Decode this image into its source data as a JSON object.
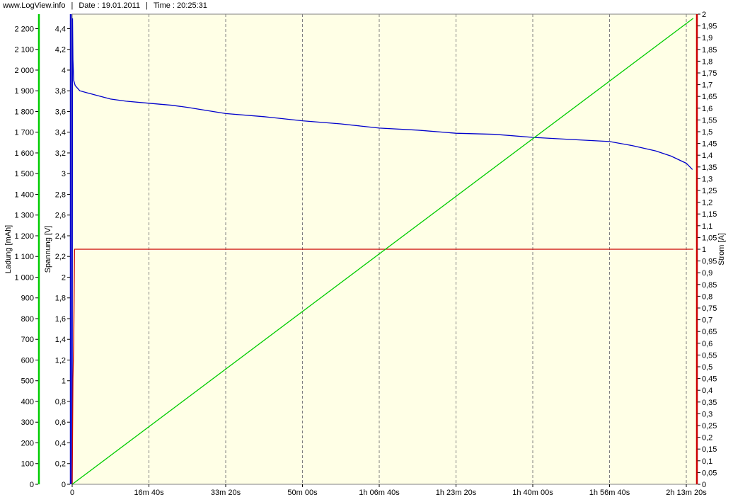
{
  "header": {
    "site": "www.LogView.info",
    "date": "Date : 19.01.2011",
    "time": "Time : 20:25:31"
  },
  "colors": {
    "plot_background": "#ffffe6",
    "ladung_axis": "#00cc00",
    "spannung_axis": "#0000cc",
    "strom_axis": "#cc0000",
    "grid": "#808080"
  },
  "chart_data": {
    "type": "line",
    "title": "",
    "xlabel": "",
    "x_unit": "seconds",
    "xlim": [
      0,
      8100
    ],
    "x_ticks": [
      {
        "value": 0,
        "label": "0"
      },
      {
        "value": 1000,
        "label": "16m 40s"
      },
      {
        "value": 2000,
        "label": "33m 20s"
      },
      {
        "value": 3000,
        "label": "50m 00s"
      },
      {
        "value": 4000,
        "label": "1h 06m 40s"
      },
      {
        "value": 5000,
        "label": "1h 23m 20s"
      },
      {
        "value": 6000,
        "label": "1h 40m 00s"
      },
      {
        "value": 7000,
        "label": "1h 56m 40s"
      },
      {
        "value": 8000,
        "label": "2h 13m 20s"
      }
    ],
    "grid": "vertical dashed",
    "axes": {
      "ladung": {
        "label": "Ladung [mAh]",
        "side": "left-outer",
        "ylim": [
          0,
          2270
        ],
        "ticks": [
          {
            "value": 0,
            "label": "0"
          },
          {
            "value": 100,
            "label": "100"
          },
          {
            "value": 200,
            "label": "200"
          },
          {
            "value": 300,
            "label": "300"
          },
          {
            "value": 400,
            "label": "400"
          },
          {
            "value": 500,
            "label": "500"
          },
          {
            "value": 600,
            "label": "600"
          },
          {
            "value": 700,
            "label": "700"
          },
          {
            "value": 800,
            "label": "800"
          },
          {
            "value": 900,
            "label": "900"
          },
          {
            "value": 1000,
            "label": "1 000"
          },
          {
            "value": 1100,
            "label": "1 100"
          },
          {
            "value": 1200,
            "label": "1 200"
          },
          {
            "value": 1300,
            "label": "1 300"
          },
          {
            "value": 1400,
            "label": "1 400"
          },
          {
            "value": 1500,
            "label": "1 500"
          },
          {
            "value": 1600,
            "label": "1 600"
          },
          {
            "value": 1700,
            "label": "1 700"
          },
          {
            "value": 1800,
            "label": "1 800"
          },
          {
            "value": 1900,
            "label": "1 900"
          },
          {
            "value": 2000,
            "label": "2 000"
          },
          {
            "value": 2100,
            "label": "2 100"
          },
          {
            "value": 2200,
            "label": "2 200"
          }
        ]
      },
      "spannung": {
        "label": "Spannung [V]",
        "side": "left-inner",
        "ylim": [
          0,
          4.54
        ],
        "ticks": [
          {
            "value": 0,
            "label": "0"
          },
          {
            "value": 0.2,
            "label": "0,2"
          },
          {
            "value": 0.4,
            "label": "0,4"
          },
          {
            "value": 0.6,
            "label": "0,6"
          },
          {
            "value": 0.8,
            "label": "0,8"
          },
          {
            "value": 1.0,
            "label": "1"
          },
          {
            "value": 1.2,
            "label": "1,2"
          },
          {
            "value": 1.4,
            "label": "1,4"
          },
          {
            "value": 1.6,
            "label": "1,6"
          },
          {
            "value": 1.8,
            "label": "1,8"
          },
          {
            "value": 2.0,
            "label": "2"
          },
          {
            "value": 2.2,
            "label": "2,2"
          },
          {
            "value": 2.4,
            "label": "2,4"
          },
          {
            "value": 2.6,
            "label": "2,6"
          },
          {
            "value": 2.8,
            "label": "2,8"
          },
          {
            "value": 3.0,
            "label": "3"
          },
          {
            "value": 3.2,
            "label": "3,2"
          },
          {
            "value": 3.4,
            "label": "3,4"
          },
          {
            "value": 3.6,
            "label": "3,6"
          },
          {
            "value": 3.8,
            "label": "3,8"
          },
          {
            "value": 4.0,
            "label": "4"
          },
          {
            "value": 4.2,
            "label": "4,2"
          },
          {
            "value": 4.4,
            "label": "4,4"
          }
        ]
      },
      "strom": {
        "label": "Strom [A]",
        "side": "right",
        "ylim": [
          0,
          2.0
        ],
        "ticks": [
          {
            "value": 0,
            "label": "0"
          },
          {
            "value": 0.05,
            "label": "0,05"
          },
          {
            "value": 0.1,
            "label": "0,1"
          },
          {
            "value": 0.15,
            "label": "0,15"
          },
          {
            "value": 0.2,
            "label": "0,2"
          },
          {
            "value": 0.25,
            "label": "0,25"
          },
          {
            "value": 0.3,
            "label": "0,3"
          },
          {
            "value": 0.35,
            "label": "0,35"
          },
          {
            "value": 0.4,
            "label": "0,4"
          },
          {
            "value": 0.45,
            "label": "0,45"
          },
          {
            "value": 0.5,
            "label": "0,5"
          },
          {
            "value": 0.55,
            "label": "0,55"
          },
          {
            "value": 0.6,
            "label": "0,6"
          },
          {
            "value": 0.65,
            "label": "0,65"
          },
          {
            "value": 0.7,
            "label": "0,7"
          },
          {
            "value": 0.75,
            "label": "0,75"
          },
          {
            "value": 0.8,
            "label": "0,8"
          },
          {
            "value": 0.85,
            "label": "0,85"
          },
          {
            "value": 0.9,
            "label": "0,9"
          },
          {
            "value": 0.95,
            "label": "0,95"
          },
          {
            "value": 1.0,
            "label": "1"
          },
          {
            "value": 1.05,
            "label": "1,05"
          },
          {
            "value": 1.1,
            "label": "1,1"
          },
          {
            "value": 1.15,
            "label": "1,15"
          },
          {
            "value": 1.2,
            "label": "1,2"
          },
          {
            "value": 1.25,
            "label": "1,25"
          },
          {
            "value": 1.3,
            "label": "1,3"
          },
          {
            "value": 1.35,
            "label": "1,35"
          },
          {
            "value": 1.4,
            "label": "1,4"
          },
          {
            "value": 1.45,
            "label": "1,45"
          },
          {
            "value": 1.5,
            "label": "1,5"
          },
          {
            "value": 1.55,
            "label": "1,55"
          },
          {
            "value": 1.6,
            "label": "1,6"
          },
          {
            "value": 1.65,
            "label": "1,65"
          },
          {
            "value": 1.7,
            "label": "1,7"
          },
          {
            "value": 1.75,
            "label": "1,75"
          },
          {
            "value": 1.8,
            "label": "1,8"
          },
          {
            "value": 1.85,
            "label": "1,85"
          },
          {
            "value": 1.9,
            "label": "1,9"
          },
          {
            "value": 1.95,
            "label": "1,95"
          },
          {
            "value": 2.0,
            "label": "2"
          }
        ]
      }
    },
    "series": [
      {
        "axis": "spannung",
        "color": "#0000cc",
        "x": [
          0,
          5,
          10,
          20,
          40,
          100,
          200,
          300,
          500,
          700,
          1000,
          1300,
          1500,
          2000,
          2500,
          3000,
          3500,
          4000,
          4500,
          5000,
          5500,
          6000,
          6500,
          7000,
          7300,
          7600,
          7800,
          8000,
          8080
        ],
        "y": [
          0,
          4.5,
          4.1,
          3.9,
          3.85,
          3.8,
          3.78,
          3.76,
          3.72,
          3.7,
          3.68,
          3.66,
          3.64,
          3.58,
          3.55,
          3.51,
          3.48,
          3.44,
          3.42,
          3.39,
          3.38,
          3.35,
          3.33,
          3.31,
          3.27,
          3.22,
          3.17,
          3.1,
          3.04
        ]
      },
      {
        "axis": "strom",
        "color": "#cc0000",
        "x": [
          0,
          10,
          20,
          30,
          8090
        ],
        "y": [
          0,
          0.45,
          0.6,
          1.0,
          1.0
        ]
      },
      {
        "axis": "ladung",
        "color": "#00cc00",
        "x": [
          0,
          8090
        ],
        "y": [
          0,
          2250
        ]
      }
    ]
  }
}
